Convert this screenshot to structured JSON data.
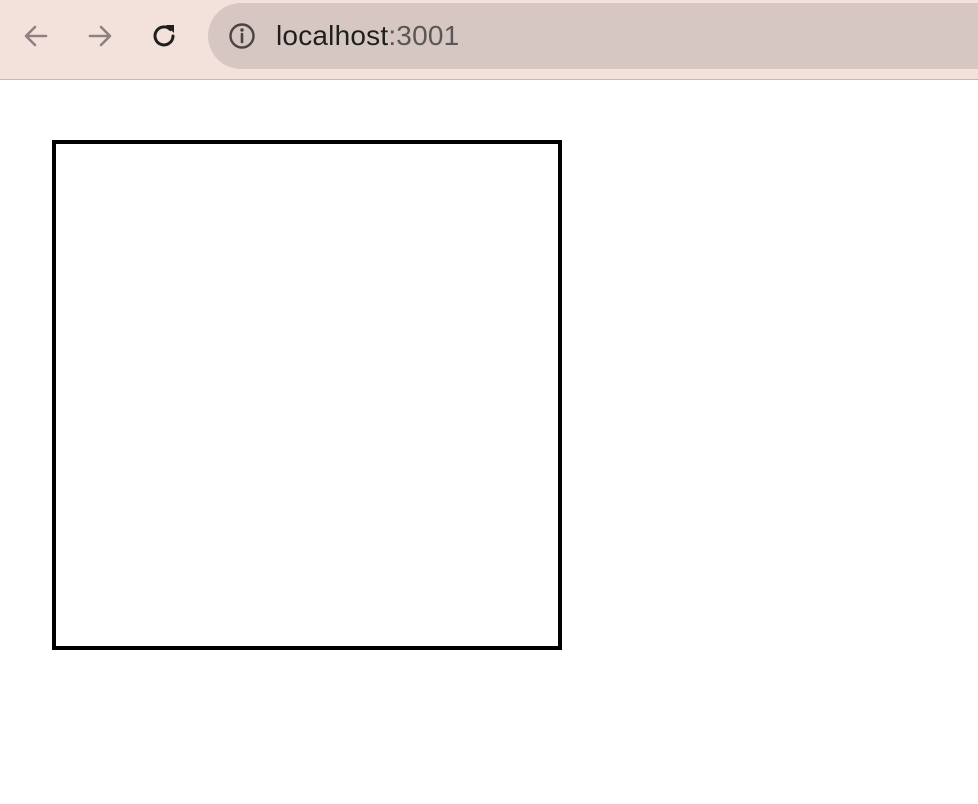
{
  "browser": {
    "url_host": "localhost",
    "url_port": ":3001",
    "icons": {
      "back": "back-arrow-icon",
      "forward": "forward-arrow-icon",
      "reload": "reload-icon",
      "site_info": "info-icon"
    },
    "colors": {
      "toolbar_bg": "#f3e2dc",
      "omnibox_bg": "#d6c7c2",
      "nav_disabled": "#8c8080",
      "nav_enabled": "#1f1f1f"
    }
  },
  "page": {
    "background": "#ffffff",
    "box_border_color": "#000000"
  }
}
